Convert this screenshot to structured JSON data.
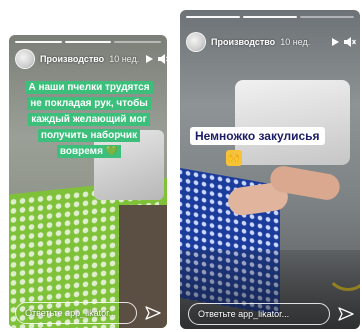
{
  "stories": [
    {
      "user": "Производство",
      "time": "10 нед.",
      "caption": "А наши пчелки трудятся не покладая рук, чтобы каждый желающий мог получить наборчик вовремя 💚",
      "reply_placeholder": "Ответьте app_likator...",
      "progress": {
        "total": 3,
        "current": 2
      }
    },
    {
      "user": "Производство",
      "time": "10 нед.",
      "caption": "Немножко закулисья",
      "emoji": "🙌",
      "reply_placeholder": "Ответьте app_likator...",
      "progress": {
        "total": 3,
        "current": 2
      }
    }
  ],
  "icons": [
    "avatar",
    "play-icon",
    "mute-icon",
    "more-icon",
    "send-icon"
  ],
  "colors": {
    "caption_green": "#3cbf7a",
    "caption_white_text": "#1b1b66",
    "mat_green": "#7fc23a",
    "mat_blue": "#1b3c9a"
  }
}
